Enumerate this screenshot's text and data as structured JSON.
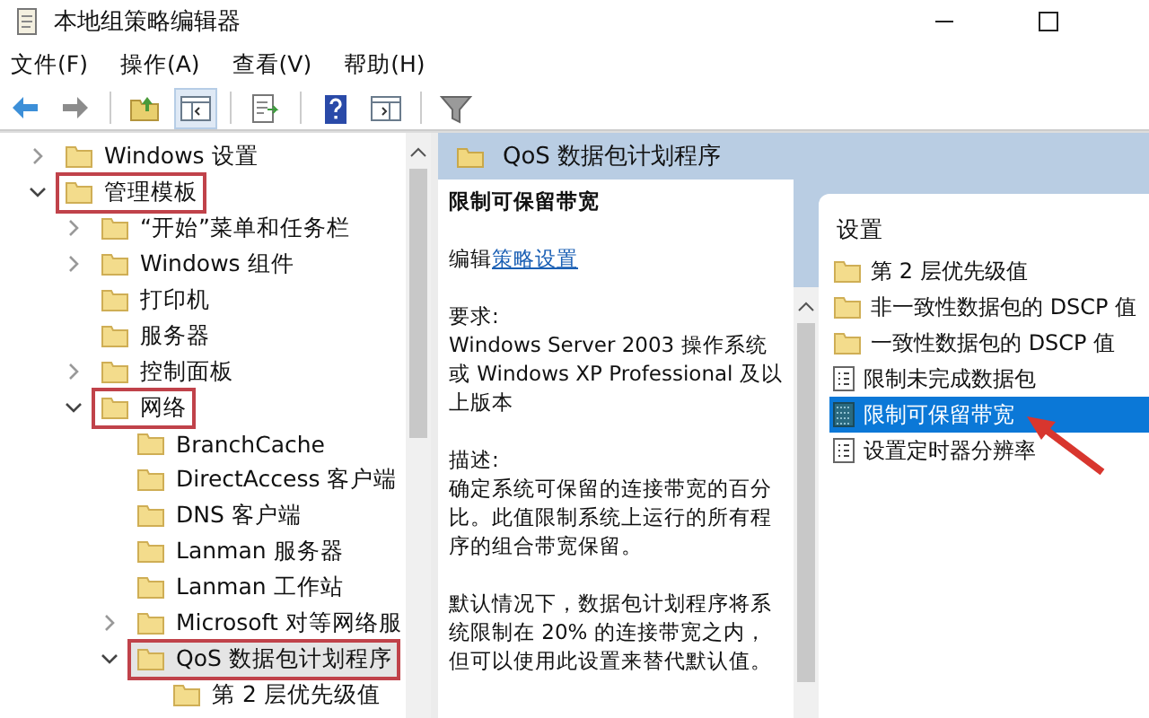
{
  "window": {
    "title": "本地组策略编辑器"
  },
  "menu": [
    "文件(F)",
    "操作(A)",
    "查看(V)",
    "帮助(H)"
  ],
  "toolbar": [
    {
      "kind": "back",
      "pressed": false
    },
    {
      "kind": "forward",
      "pressed": false
    },
    {
      "kind": "sep"
    },
    {
      "kind": "folder-up",
      "pressed": false
    },
    {
      "kind": "tree-toggle",
      "pressed": true
    },
    {
      "kind": "sep"
    },
    {
      "kind": "export",
      "pressed": false
    },
    {
      "kind": "sep"
    },
    {
      "kind": "help",
      "pressed": false
    },
    {
      "kind": "panel",
      "pressed": false
    },
    {
      "kind": "sep"
    },
    {
      "kind": "filter",
      "pressed": false
    }
  ],
  "tree": [
    {
      "label": "Windows 设置",
      "expanded": false,
      "selected": false,
      "annotated": false
    },
    {
      "label": "管理模板",
      "expanded": true,
      "selected": false,
      "annotated": true,
      "children": [
        {
          "label": "“开始”菜单和任务栏",
          "expanded": false,
          "selected": false,
          "annotated": false
        },
        {
          "label": "Windows 组件",
          "expanded": false,
          "selected": false,
          "annotated": false
        },
        {
          "label": "打印机",
          "selected": false,
          "annotated": false
        },
        {
          "label": "服务器",
          "selected": false,
          "annotated": false
        },
        {
          "label": "控制面板",
          "expanded": false,
          "selected": false,
          "annotated": false
        },
        {
          "label": "网络",
          "expanded": true,
          "selected": false,
          "annotated": true,
          "children": [
            {
              "label": "BranchCache",
              "selected": false,
              "annotated": false
            },
            {
              "label": "DirectAccess 客户端",
              "selected": false,
              "annotated": false
            },
            {
              "label": "DNS 客户端",
              "selected": false,
              "annotated": false
            },
            {
              "label": "Lanman 服务器",
              "selected": false,
              "annotated": false
            },
            {
              "label": "Lanman 工作站",
              "selected": false,
              "annotated": false
            },
            {
              "label": "Microsoft 对等网络服",
              "expanded": false,
              "selected": false,
              "annotated": false
            },
            {
              "label": "QoS 数据包计划程序",
              "expanded": true,
              "selected": true,
              "annotated": true,
              "children": [
                {
                  "label": "第 2 层优先级值",
                  "selected": false,
                  "annotated": false
                }
              ]
            }
          ]
        }
      ]
    }
  ],
  "header": {
    "title": "QoS 数据包计划程序"
  },
  "description": {
    "title": "限制可保留带宽",
    "edit_prefix": "编辑",
    "edit_link": "策略设置",
    "requirements_label": "要求:",
    "requirements": "Windows Server 2003 操作系统或 Windows XP Professional 及以上版本",
    "description_label": "描述:",
    "paragraphs": [
      "确定系统可保留的连接带宽的百分比。此值限制系统上运行的所有程序的组合带宽保留。",
      "默认情况下，数据包计划程序将系统限制在 20% 的连接带宽之内，但可以使用此设置来替代默认值。"
    ]
  },
  "settings": {
    "column": "设置",
    "items": [
      {
        "label": "第 2 层优先级值",
        "kind": "folder",
        "selected": false,
        "annotated": false
      },
      {
        "label": "非一致性数据包的 DSCP 值",
        "kind": "folder",
        "selected": false,
        "annotated": false
      },
      {
        "label": "一致性数据包的 DSCP 值",
        "kind": "folder",
        "selected": false,
        "annotated": false
      },
      {
        "label": "限制未完成数据包",
        "kind": "setting",
        "selected": false,
        "annotated": false
      },
      {
        "label": "限制可保留带宽",
        "kind": "setting",
        "selected": true,
        "annotated": true
      },
      {
        "label": "设置定时器分辨率",
        "kind": "setting",
        "selected": false,
        "annotated": false
      }
    ]
  }
}
